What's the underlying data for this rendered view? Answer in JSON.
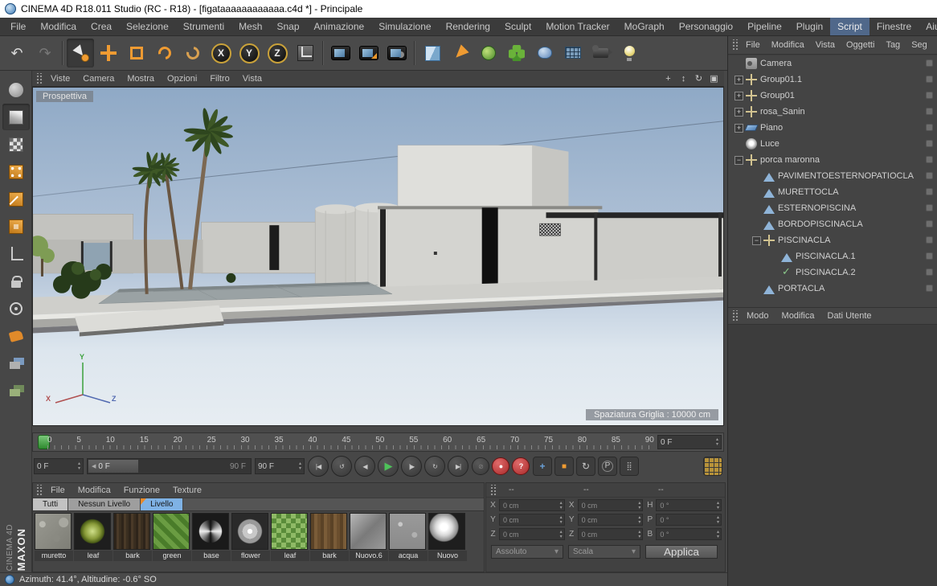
{
  "colors": {
    "accent_orange": "#ef9b32",
    "menu_highlight": "#50688a",
    "play_green": "#4ec25a",
    "record_red": "#a82a2a"
  },
  "title_bar": {
    "title": "CINEMA 4D R18.011 Studio (RC - R18) - [figataaaaaaaaaaaa.c4d *] - Principale"
  },
  "menu_bar": {
    "active_item": "Script",
    "items": [
      {
        "label": "File"
      },
      {
        "label": "Modifica"
      },
      {
        "label": "Crea"
      },
      {
        "label": "Selezione"
      },
      {
        "label": "Strumenti"
      },
      {
        "label": "Mesh"
      },
      {
        "label": "Snap"
      },
      {
        "label": "Animazione"
      },
      {
        "label": "Simulazione"
      },
      {
        "label": "Rendering"
      },
      {
        "label": "Sculpt"
      },
      {
        "label": "Motion Tracker"
      },
      {
        "label": "MoGraph"
      },
      {
        "label": "Personaggio"
      },
      {
        "label": "Pipeline"
      },
      {
        "label": "Plugin"
      },
      {
        "label": "Script",
        "cls": "active"
      },
      {
        "label": "Finestre"
      },
      {
        "label": "Aiuto"
      }
    ]
  },
  "toolbar": {
    "undo_glyph": "↶",
    "redo_glyph": "↷",
    "axis_buttons": [
      "X",
      "Y",
      "Z"
    ]
  },
  "viewport": {
    "menu_items": [
      {
        "label": "Viste"
      },
      {
        "label": "Camera"
      },
      {
        "label": "Mostra"
      },
      {
        "label": "Opzioni"
      },
      {
        "label": "Filtro"
      },
      {
        "label": "Vista"
      }
    ],
    "controls": [
      {
        "glyph": "+"
      },
      {
        "glyph": "↕"
      },
      {
        "glyph": "↻"
      },
      {
        "glyph": "▣"
      }
    ],
    "view_label": "Prospettiva",
    "grid_label": "Spaziatura Griglia : 10000 cm",
    "axis": {
      "x": "X",
      "y": "Y",
      "z": "Z"
    }
  },
  "object_manager": {
    "menu_items": [
      {
        "label": "File"
      },
      {
        "label": "Modifica"
      },
      {
        "label": "Vista"
      },
      {
        "label": "Oggetti"
      },
      {
        "label": "Tag"
      },
      {
        "label": "Seg"
      }
    ],
    "items": [
      {
        "label": "Camera",
        "icon": "icon-camera",
        "cls": "indent-0",
        "expander": ""
      },
      {
        "label": "Group01.1",
        "icon": "icon-null",
        "cls": "indent-0",
        "expander": "+"
      },
      {
        "label": "Group01",
        "icon": "icon-null",
        "cls": "indent-0",
        "expander": "+"
      },
      {
        "label": "rosa_Sanin",
        "icon": "icon-null",
        "cls": "indent-0",
        "expander": "+"
      },
      {
        "label": "Piano",
        "icon": "icon-plane",
        "cls": "indent-0",
        "expander": "+"
      },
      {
        "label": "Luce",
        "icon": "icon-light",
        "cls": "indent-0",
        "expander": ""
      },
      {
        "label": "porca maronna",
        "icon": "icon-null",
        "cls": "indent-0",
        "expander": "−"
      },
      {
        "label": "PAVIMENTOESTERNOPATIOCLA",
        "icon": "icon-polygon",
        "cls": "indent-1",
        "expander": ""
      },
      {
        "label": "MURETTOCLA",
        "icon": "icon-polygon",
        "cls": "indent-1",
        "expander": ""
      },
      {
        "label": "ESTERNOPISCINA",
        "icon": "icon-polygon",
        "cls": "indent-1",
        "expander": ""
      },
      {
        "label": "BORDOPISCINACLA",
        "icon": "icon-polygon",
        "cls": "indent-1",
        "expander": ""
      },
      {
        "label": "PISCINACLA",
        "icon": "icon-null",
        "cls": "indent-1",
        "expander": "−"
      },
      {
        "label": "PISCINACLA.1",
        "icon": "icon-polygon",
        "cls": "indent-2",
        "expander": ""
      },
      {
        "label": "PISCINACLA.2",
        "icon": "icon-spline",
        "cls": "indent-2",
        "expander": ""
      },
      {
        "label": "PORTACLA",
        "icon": "icon-polygon",
        "cls": "indent-1",
        "expander": ""
      }
    ]
  },
  "attribute_manager": {
    "tabs": [
      {
        "label": "Modo"
      },
      {
        "label": "Modifica"
      },
      {
        "label": "Dati Utente"
      }
    ]
  },
  "timeline": {
    "frame_field": "0 F",
    "ticks": [
      {
        "label": "0"
      },
      {
        "label": "5"
      },
      {
        "label": "10"
      },
      {
        "label": "15"
      },
      {
        "label": "20"
      },
      {
        "label": "25"
      },
      {
        "label": "30"
      },
      {
        "label": "35"
      },
      {
        "label": "40"
      },
      {
        "label": "45"
      },
      {
        "label": "50"
      },
      {
        "label": "55"
      },
      {
        "label": "60"
      },
      {
        "label": "65"
      },
      {
        "label": "70"
      },
      {
        "label": "75"
      },
      {
        "label": "80"
      },
      {
        "label": "85"
      },
      {
        "label": "90"
      }
    ]
  },
  "transport": {
    "start_field": "0 F",
    "range_start": "0 F",
    "range_end": "90 F",
    "end_field": "90 F",
    "buttons": [
      {
        "glyph": "|◀",
        "cls": ""
      },
      {
        "glyph": "↺",
        "cls": ""
      },
      {
        "glyph": "◀",
        "cls": ""
      },
      {
        "glyph": "▶",
        "cls": "play"
      },
      {
        "glyph": "|▶",
        "cls": ""
      },
      {
        "glyph": "↻",
        "cls": ""
      },
      {
        "glyph": "▶|",
        "cls": ""
      }
    ],
    "record_buttons": [
      {
        "glyph": "⊘",
        "cls": "dis"
      },
      {
        "glyph": "●",
        "cls": "rec"
      },
      {
        "glyph": "?",
        "cls": "rec"
      }
    ],
    "key_toggles": [
      {
        "glyph": "+",
        "cls": "k-pos"
      },
      {
        "glyph": "■",
        "cls": "k-scale"
      },
      {
        "glyph": "↻",
        "cls": "k-rot"
      },
      {
        "glyph": "P",
        "cls": "k-param"
      },
      {
        "glyph": "⣿",
        "cls": "k-pla"
      }
    ]
  },
  "material_manager": {
    "menu_items": [
      {
        "label": "File"
      },
      {
        "label": "Modifica"
      },
      {
        "label": "Funzione"
      },
      {
        "label": "Texture"
      }
    ],
    "tabs": [
      {
        "label": "Tutti",
        "cls": "tab-light"
      },
      {
        "label": "Nessun Livello",
        "cls": "tab-mid"
      },
      {
        "label": "Livello",
        "cls": "tab-blue"
      }
    ],
    "materials": [
      {
        "label": "muretto",
        "thumb": "mat-muretto"
      },
      {
        "label": "leaf",
        "thumb": "mat-leaf-a"
      },
      {
        "label": "bark",
        "thumb": "mat-bark-a"
      },
      {
        "label": "green",
        "thumb": "mat-green"
      },
      {
        "label": "base",
        "thumb": "mat-base"
      },
      {
        "label": "flower",
        "thumb": "mat-flower"
      },
      {
        "label": "leaf",
        "thumb": "mat-leaf-b"
      },
      {
        "label": "bark",
        "thumb": "mat-bark-b"
      },
      {
        "label": "Nuovo.6",
        "thumb": "mat-nuovo6"
      },
      {
        "label": "acqua",
        "thumb": "mat-acqua"
      },
      {
        "label": "Nuovo",
        "thumb": "mat-nuovo"
      }
    ]
  },
  "coordinate_manager": {
    "headers": [
      {
        "label": "--"
      },
      {
        "label": "--"
      },
      {
        "label": "--"
      }
    ],
    "position": [
      {
        "label": "X",
        "value": "0 cm"
      },
      {
        "label": "Y",
        "value": "0 cm"
      },
      {
        "label": "Z",
        "value": "0 cm"
      }
    ],
    "size": [
      {
        "label": "X",
        "value": "0 cm"
      },
      {
        "label": "Y",
        "value": "0 cm"
      },
      {
        "label": "Z",
        "value": "0 cm"
      }
    ],
    "rotation": [
      {
        "label": "H",
        "value": "0 °"
      },
      {
        "label": "P",
        "value": "0 °"
      },
      {
        "label": "B",
        "value": "0 °"
      }
    ],
    "mode_dropdown": "Assoluto",
    "scale_dropdown": "Scala",
    "apply_button": "Applica"
  },
  "branding": {
    "maxon": "MAXON",
    "cinema4d": "CINEMA 4D"
  },
  "status_bar": {
    "text": "Azimuth: 41.4°, Altitudine: -0.6°  SO"
  }
}
